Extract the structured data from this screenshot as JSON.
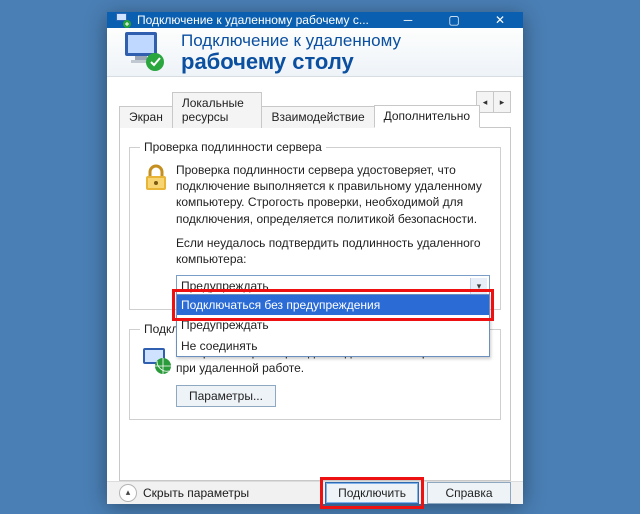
{
  "window": {
    "title": "Подключение к удаленному рабочему с..."
  },
  "header": {
    "line1": "Подключение к удаленному",
    "line2": "рабочему столу"
  },
  "tabs": {
    "items": [
      {
        "label": "Экран"
      },
      {
        "label": "Локальные ресурсы"
      },
      {
        "label": "Взаимодействие"
      },
      {
        "label": "Дополнительно"
      }
    ],
    "active_index": 3
  },
  "auth_group": {
    "legend": "Проверка подлинности сервера",
    "text": "Проверка подлинности сервера удостоверяет, что подключение выполняется к правильному удаленному компьютеру. Строгость проверки, необходимой для подключения, определяется политикой безопасности.",
    "prompt": "Если неудалось подтвердить подлинность удаленного компьютера:",
    "combo_value": "Предупреждать",
    "options": [
      "Подключаться без предупреждения",
      "Предупреждать",
      "Не соединять"
    ],
    "selected_option_index": 0
  },
  "gateway_group": {
    "legend": "Подключение из любого места",
    "text": "Настройка параметров для подключения через шлюз при удаленной работе.",
    "button": "Параметры..."
  },
  "footer": {
    "collapse_label": "Скрыть параметры",
    "connect": "Подключить",
    "help": "Справка"
  }
}
